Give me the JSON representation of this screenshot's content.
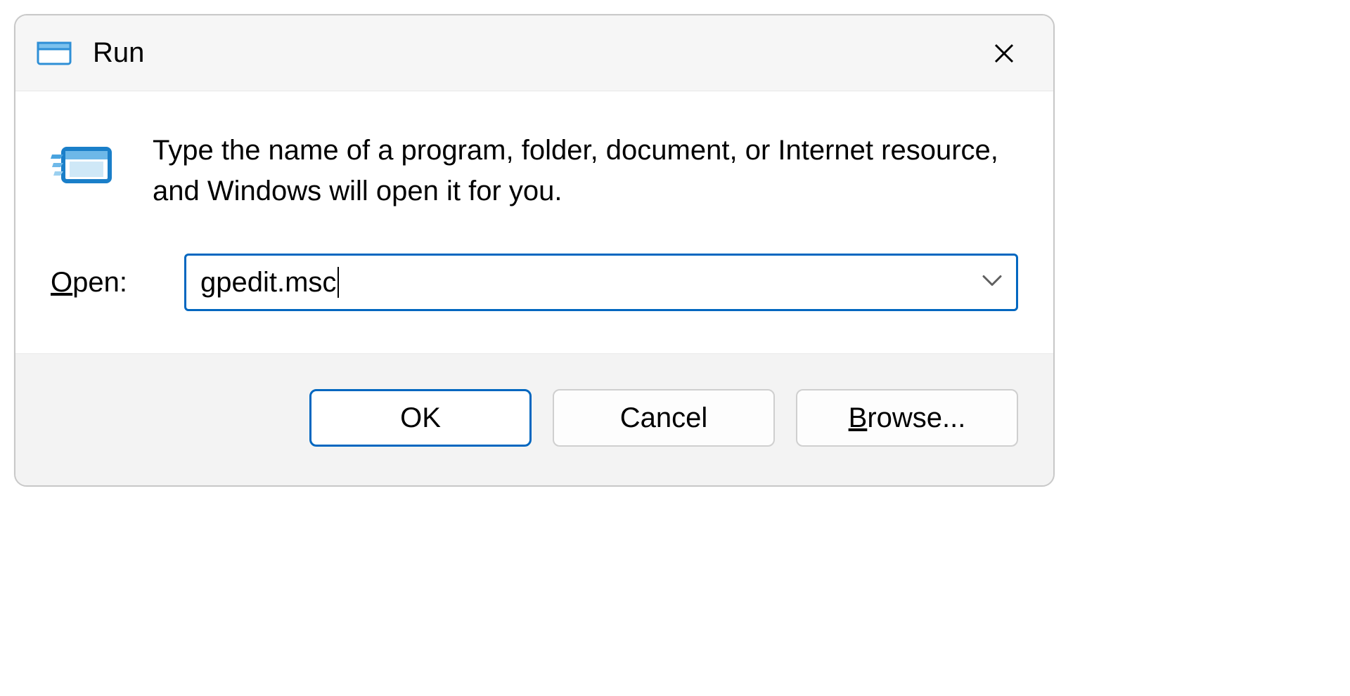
{
  "titlebar": {
    "title": "Run"
  },
  "content": {
    "description": "Type the name of a program, folder, document, or Internet resource, and Windows will open it for you.",
    "open_label_prefix": "O",
    "open_label_rest": "pen:",
    "input_value": "gpedit.msc"
  },
  "footer": {
    "ok": "OK",
    "cancel": "Cancel",
    "browse_prefix": "B",
    "browse_rest": "rowse..."
  }
}
